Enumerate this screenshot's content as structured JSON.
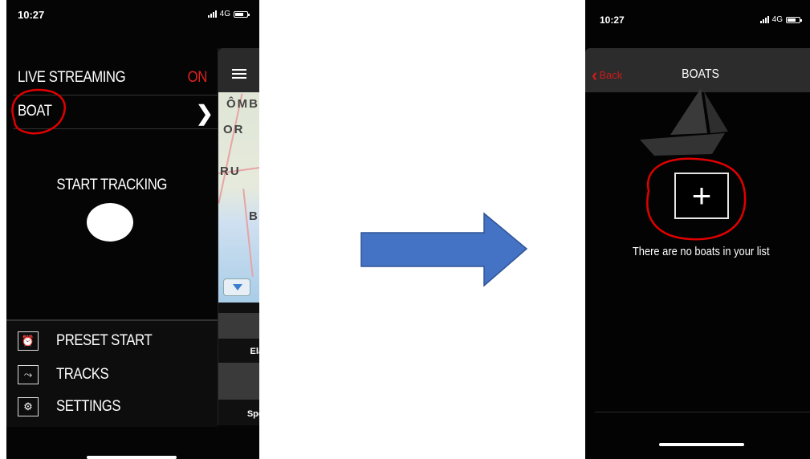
{
  "left_screen": {
    "status": {
      "time": "10:27",
      "network": "4G"
    },
    "live_streaming_label": "LIVE STREAMING",
    "live_streaming_state": "ON",
    "boat_label": "BOAT",
    "start_tracking_label": "START TRACKING",
    "map_labels": [
      "ÔMB",
      "OR",
      "RU",
      "B"
    ],
    "panel_labels": [
      "Ela",
      "Spe"
    ],
    "bottom_menu": [
      {
        "label": "PRESET START",
        "icon": "alarm-clock-icon"
      },
      {
        "label": "TRACKS",
        "icon": "track-path-icon"
      },
      {
        "label": "SETTINGS",
        "icon": "gear-icon"
      }
    ]
  },
  "right_screen": {
    "status": {
      "time": "10:27",
      "network": "4G"
    },
    "back_label": "Back",
    "title": "BOATS",
    "add_symbol": "+",
    "empty_message": "There are no boats in your list"
  },
  "colors": {
    "on_red": "#e02020",
    "back_red": "#cc1a1a",
    "arrow_fill": "#4472c4",
    "annotation_red": "#e00000"
  },
  "annotations": [
    "circle-around-boat-label",
    "circle-around-add-button"
  ]
}
